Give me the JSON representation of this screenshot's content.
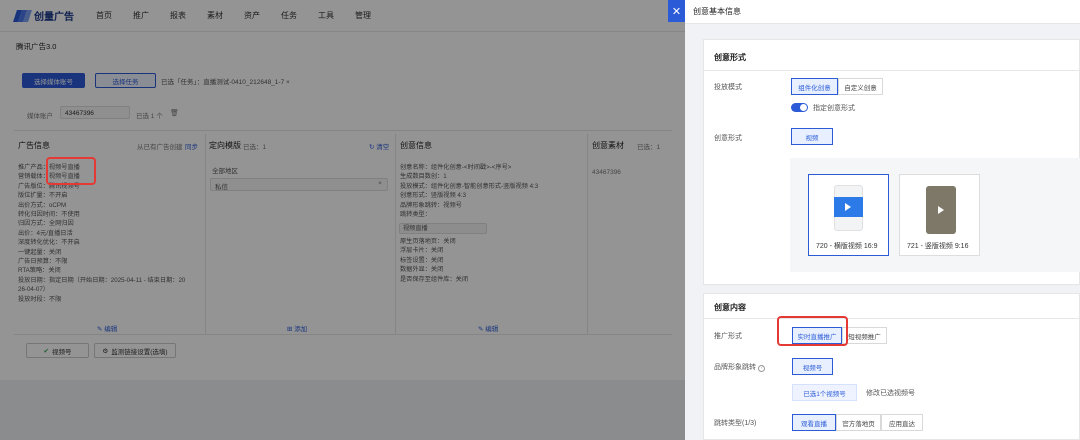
{
  "app": {
    "logo_text": "创量广告",
    "nav": [
      "首页",
      "推广",
      "报表",
      "素材",
      "资产",
      "任务",
      "工具",
      "管理"
    ],
    "page_title": "腾讯广告3.0",
    "toolbar": {
      "select_media_account": "选择媒体账号",
      "select_task": "选择任务",
      "selected_task_text": "已选「任务」：直播测试-0410_212648_1-7 ×"
    },
    "media_account": {
      "label": "媒体账户",
      "value": "43467396",
      "selected_count": "已选 1 个",
      "clear_icon": "trash-icon"
    },
    "columns": {
      "ad_info": {
        "title": "广告信息",
        "from_existing": "从已有广告创建",
        "sync": "同步"
      },
      "targeting": {
        "title": "定向模版",
        "count": "已选：1",
        "clear": "清空"
      },
      "creative": {
        "title": "创意信息"
      },
      "material": {
        "title": "创意素材",
        "count": "已选：1"
      }
    },
    "ad_info_rows": [
      "推广产品：视频号直播",
      "营销载体：视频号直播",
      "广告版位：腾讯视频号",
      "版位扩量：不开启",
      "出价方式：oCPM",
      "转化归因时间：不使用",
      "归因方式：全网归因",
      "出价：4元/直播日活",
      "深度转化优化：不开启",
      "一键起量：关闭",
      "广告日预算：不限",
      "RTA策略：关闭",
      "投放日期：指定日期（开始日期：2025-04-11 - 结束日期：20",
      "26-04-07）",
      "投放时段：不限"
    ],
    "ad_info_edit": "编辑",
    "targeting": {
      "scope": "全部地区",
      "tag": "私信",
      "add": "添加"
    },
    "creative_rows": [
      "创意名称：组件化创意-<时间戳>-<序号>",
      "生成数目数创：1",
      "投放模式：组件化创意-智能创意形式-竖版视频 4:3",
      "创意形式：竖版视频 4:3",
      "品牌形象跳转：视频号",
      "跳转类型：",
      "视频直播",
      "原生页落地页：关闭",
      "浮层卡片：关闭",
      "标签设置：关闭",
      "数据外显：关闭",
      "是否保存至组件库：关闭"
    ],
    "creative_edit": "编辑",
    "material": {
      "id": "43467396"
    },
    "bottom": {
      "video_account": "视频号",
      "monitor_link": "监测链接设置(选填)"
    }
  },
  "drawer": {
    "title": "创意基本信息",
    "close_icon": "close-icon",
    "creative_form": {
      "section": "创意形式",
      "delivery_mode_label": "投放模式",
      "delivery_modes": [
        "组件化创意",
        "自定义创意"
      ],
      "selected_mode": "组件化创意",
      "specify_toggle_label": "指定创意形式",
      "specify_toggle_on": true,
      "form_label": "创意形式",
      "form_value": "视频",
      "formats": [
        {
          "label": "720 - 横版视频 16:9",
          "selected": true
        },
        {
          "label": "721 - 竖版视频 9:16",
          "selected": false
        }
      ]
    },
    "creative_content": {
      "section": "创意内容",
      "promo_label": "推广形式",
      "promo_options": [
        "实时直播推广",
        "短视频推广"
      ],
      "promo_selected": "实时直播推广",
      "brand_label": "品牌形象跳转",
      "brand_help_icon": "question-circle-icon",
      "brand_value": "视频号",
      "selected_video": "已选1个视频号",
      "edit_video": "修改已选视频号",
      "jump_label": "跳转类型(1/3)",
      "jump_options": [
        "观看直播",
        "官方落地页",
        "应用直达"
      ],
      "jump_selected": "观看直播"
    }
  },
  "colors": {
    "accent": "#2b5bd7",
    "highlight": "#e53935"
  }
}
